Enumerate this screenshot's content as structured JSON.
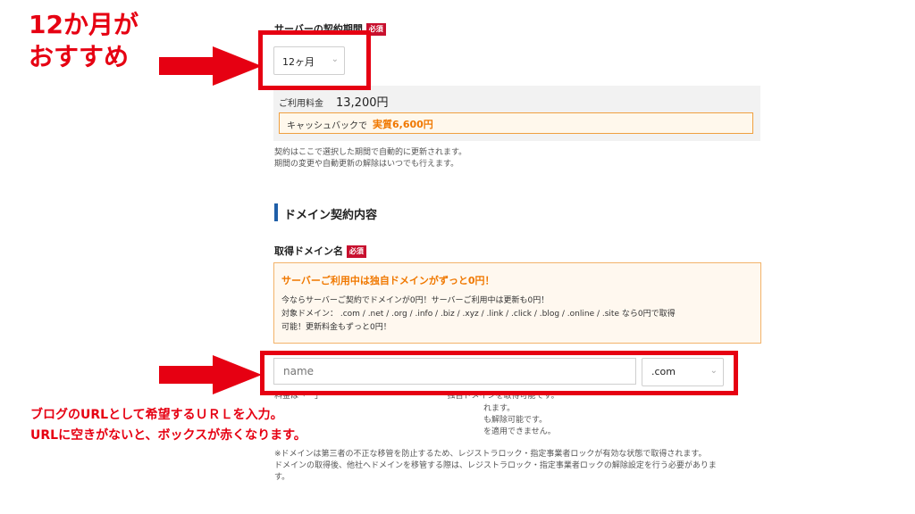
{
  "server_period": {
    "label": "サーバーの契約期間",
    "required_badge": "必須",
    "selected": "12ヶ月"
  },
  "fee": {
    "label": "ご利用料金",
    "amount": "13,200円",
    "cashback_prefix": "キャッシュバックで",
    "cashback_value": "実質6,600円"
  },
  "period_notes": [
    "契約はここで選択した期間で自動的に更新されます。",
    "期間の変更や自動更新の解除はいつでも行えます。"
  ],
  "domain_section": {
    "heading": "ドメイン契約内容",
    "field_label": "取得ドメイン名",
    "required_badge": "必須",
    "info_title": "サーバーご利用中は独自ドメインがずっと0円！",
    "info_line1": "今ならサーバーご契約でドメインが0円！サーバーご利用中は更新も0円！",
    "info_line2": "対象ドメイン： .com / .net / .org / .info / .biz / .xyz / .link / .click / .blog / .online / .site なら0円で取得",
    "info_line3": "可能！更新料金もずっと0円！",
    "input_placeholder": "name",
    "tld_selected": ".com"
  },
  "partial_notes": [
    "料金は「　」　　　　　　　　　　　　　　　　独自ドメインを取得可能です。",
    "れます。",
    "も解除可能です。",
    "を適用できません。"
  ],
  "lock_notes": [
    "※ドメインは第三者の不正な移管を防止するため、レジストラロック・指定事業者ロックが有効な状態で取得されます。",
    "ドメインの取得後、他社へドメインを移管する際は、レジストラロック・指定事業者ロックの解除設定を行う必要がありま",
    "す。"
  ],
  "annotations": {
    "recommend_line1": "12か月が",
    "recommend_line2": "おすすめ",
    "url_line1": "ブログのURLとして希望するＵＲＬを入力。",
    "url_line2": "URLに空きがないと、ボックスが赤くなります。"
  },
  "colors": {
    "annotation_red": "#e60012",
    "badge_red": "#c8102e",
    "heading_bar": "#1f5fa8",
    "info_orange": "#f07800"
  }
}
